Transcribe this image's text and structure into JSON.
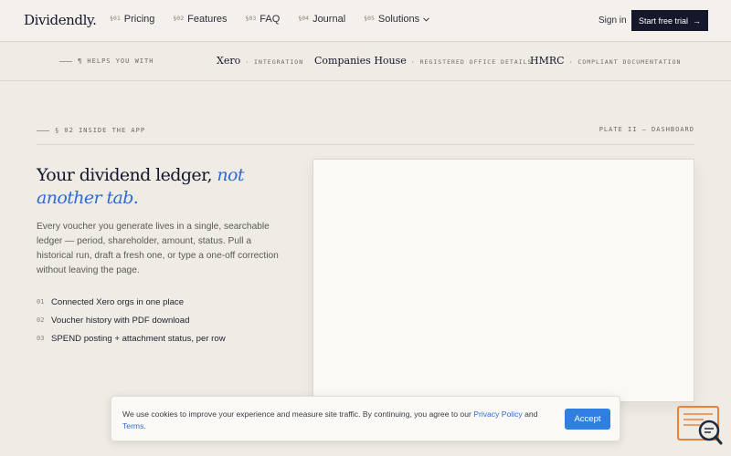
{
  "nav": {
    "logo": "Dividendly",
    "logo_dot": ".",
    "links": [
      {
        "num": "§01",
        "label": "Pricing"
      },
      {
        "num": "§02",
        "label": "Features"
      },
      {
        "num": "§03",
        "label": "FAQ"
      },
      {
        "num": "§04",
        "label": "Journal"
      },
      {
        "num": "§05",
        "label": "Solutions"
      }
    ],
    "signin": "Sign in",
    "cta": "Start free trial",
    "cta_arrow": "→"
  },
  "helps": {
    "label": "¶ HELPS YOU WITH",
    "partners": [
      {
        "name": "Xero",
        "desc": "· INTEGRATION"
      },
      {
        "name": "Companies House",
        "desc": "· REGISTERED OFFICE DETAILS"
      },
      {
        "name": "HMRC",
        "desc": "· COMPLIANT DOCUMENTATION"
      }
    ]
  },
  "section": {
    "label": "§ 02 INSIDE THE APP",
    "plate": "PLATE II — DASHBOARD",
    "heading_main": "Your dividend ledger, ",
    "heading_accent": "not another tab.",
    "description": "Every voucher you generate lives in a single, searchable ledger — period, shareholder, amount, status. Pull a historical run, draft a fresh one, or type a one-off correction without leaving the page.",
    "features": [
      {
        "num": "01",
        "text": "Connected Xero orgs in one place"
      },
      {
        "num": "02",
        "text": "Voucher history with PDF download"
      },
      {
        "num": "03",
        "text": "SPEND posting + attachment status, per row"
      }
    ]
  },
  "cookie": {
    "text_before": "We use cookies to improve your experience and measure site traffic. By continuing, you agree to our ",
    "privacy_link": "Privacy Policy",
    "text_and": " and ",
    "terms_link": "Terms",
    "text_end": ".",
    "accept": "Accept"
  },
  "colors": {
    "accent": "#2f6bd1",
    "cta_bg": "#15172a",
    "accept_bg": "#2f7fe0",
    "widget": "#e8833a"
  },
  "icons": {
    "solutions_dropdown": "chevron-down-icon",
    "cta_arrow": "arrow-right-icon",
    "help_widget": "chat-search-icon"
  }
}
